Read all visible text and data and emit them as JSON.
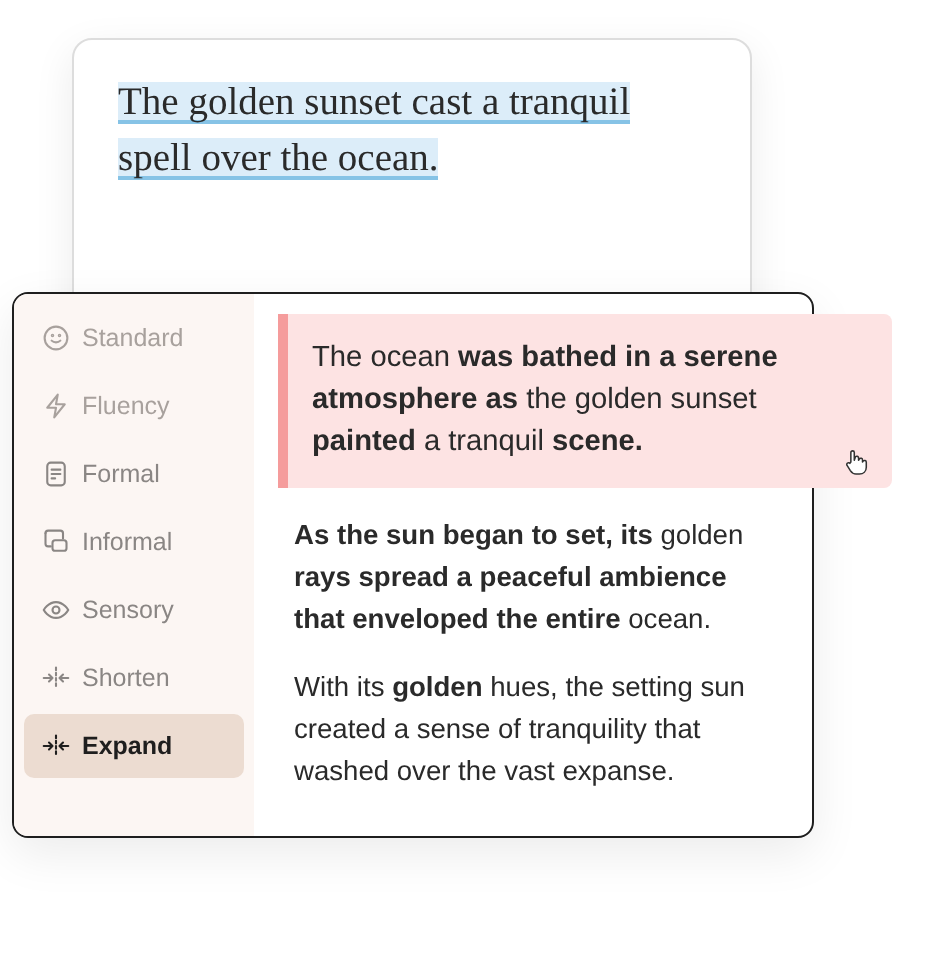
{
  "source_card": {
    "text": "The golden sunset cast a tranquil spell over the ocean.",
    "highlighted": true
  },
  "sidebar": {
    "items": [
      {
        "label": "Standard",
        "selected": false,
        "faded": true
      },
      {
        "label": "Fluency",
        "selected": false,
        "faded": true
      },
      {
        "label": "Formal",
        "selected": false,
        "faded": false
      },
      {
        "label": "Informal",
        "selected": false,
        "faded": false
      },
      {
        "label": "Sensory",
        "selected": false,
        "faded": false
      },
      {
        "label": "Shorten",
        "selected": false,
        "faded": false
      },
      {
        "label": "Expand",
        "selected": true,
        "faded": false
      }
    ]
  },
  "suggestions": [
    {
      "text": "The ocean **was bathed in a serene atmosphere as** the golden sunset **painted** a tranquil **scene.**",
      "selected": true
    },
    {
      "text": "**As the sun began to set, its** golden **rays spread a peaceful ambience that enveloped the entire** ocean.",
      "selected": false
    },
    {
      "text": "With its **golden** hues, the setting sun created a sense of tranquility that washed over the vast expanse.",
      "selected": false
    }
  ]
}
